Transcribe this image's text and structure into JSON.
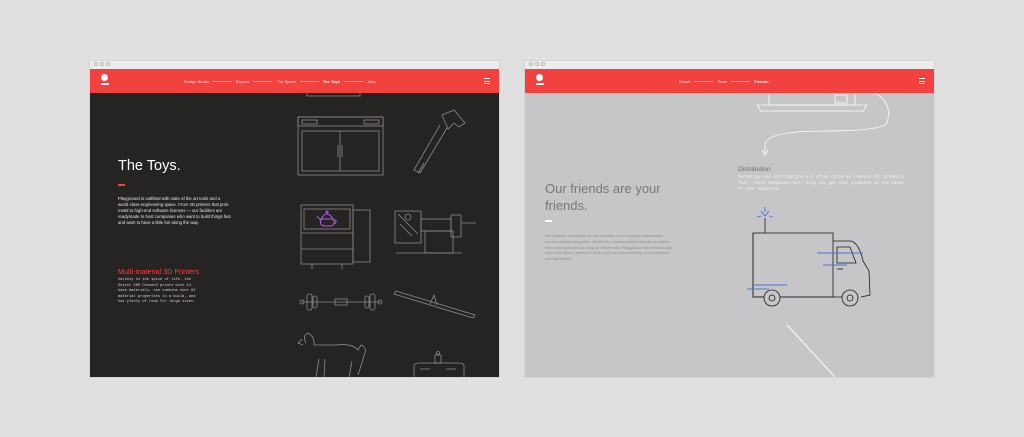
{
  "left": {
    "nav": {
      "items": [
        "Design Studio",
        "Explore",
        "The Space",
        "The Toys",
        "Jobs"
      ],
      "active": "The Toys"
    },
    "title": "The Toys.",
    "intro": "Playground is outfitted with state of the art tools and a world-class engineering space. From 3D printers that print metal to high-end software licenses — our facilities are readymade to host companies who want to build things fast and want to have a little fun along the way.",
    "subheading": "Multi-material 3D Printers",
    "detail": "Variety is the spice of life. the Object 500 Connex3 prints with 14 base materials, can combine over 82 material properties in a build, and has plenty of room for large sizes."
  },
  "right": {
    "nav": {
      "items": [
        "Bench",
        "Team",
        "Friends"
      ],
      "active": "Friends"
    },
    "title": "Our friends are your friends.",
    "intro": "Our portfolio companies get the benefits of our ongoing relationships across multiple categories. We find the commonalities that all companies need and share and we look for efficiencies. Playground has relationships with world-class partners in fields such as manufacturing, cloud services and distribution.",
    "section_title": "Distribution",
    "section_body": "Marketing and distribution are often cited as reasons hit products fail, these companies will help you get your products in the hands of your audience"
  },
  "colors": {
    "accent": "#f2423f",
    "dark_bg": "#262323",
    "gray_bg": "#c6c5c7",
    "outline": "#8e8b88",
    "purple": "#b55cf0",
    "blue": "#4a74d8"
  },
  "icons": [
    "menu-icon",
    "logo-icon",
    "printer-illustration",
    "hammer-illustration",
    "teapot-illustration",
    "lathe-illustration",
    "dumbbell-illustration",
    "seesaw-illustration",
    "dog-illustration",
    "delivery-truck-illustration",
    "laptop-illustration"
  ]
}
